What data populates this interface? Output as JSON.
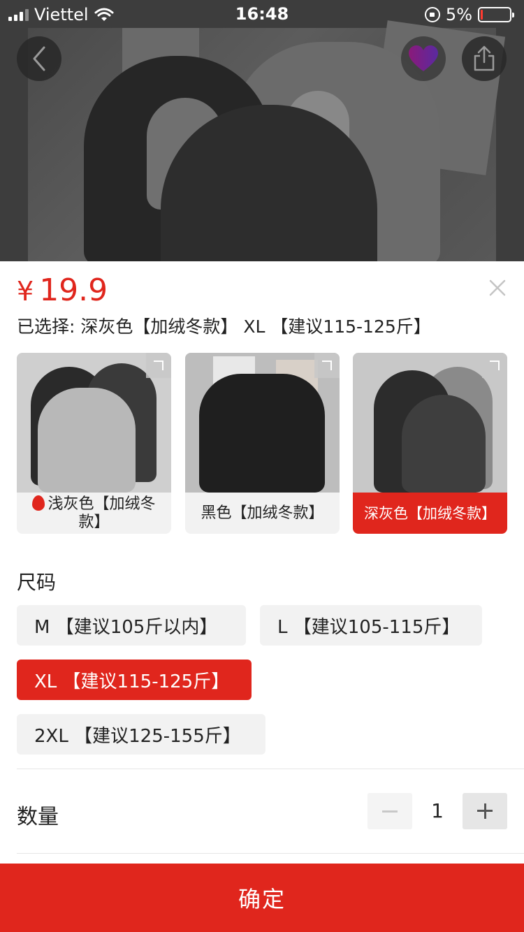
{
  "status_bar": {
    "carrier": "Viettel",
    "time": "16:48",
    "battery_percent": "5%",
    "battery_level": 0.05,
    "icons": [
      "signal-icon",
      "wifi-icon",
      "rotation-lock-icon",
      "battery-icon"
    ]
  },
  "header": {
    "back_icon": "chevron-left-icon",
    "favorite_icon": "heart-icon",
    "share_icon": "share-icon"
  },
  "product": {
    "currency": "¥",
    "price": "19.9",
    "selected_text": "已选择: 深灰色【加绒冬款】 XL 【建议115-125斤】",
    "close_icon": "close-icon"
  },
  "colors": {
    "accent": "#e0261d",
    "option_bg": "#f2f2f2"
  },
  "swatches": [
    {
      "label": "浅灰色【加绒冬款】",
      "hot": true,
      "active": false
    },
    {
      "label": "黑色【加绒冬款】",
      "hot": false,
      "active": false
    },
    {
      "label": "深灰色【加绒冬款】",
      "hot": false,
      "active": true
    }
  ],
  "sizes": {
    "title": "尺码",
    "options": [
      {
        "label": "M 【建议105斤以内】",
        "active": false
      },
      {
        "label": "L 【建议105-115斤】",
        "active": false
      },
      {
        "label": "XL 【建议115-125斤】",
        "active": true
      },
      {
        "label": "2XL 【建议125-155斤】",
        "active": false
      }
    ]
  },
  "quantity": {
    "label": "数量",
    "value": "1",
    "minus_icon": "minus-icon",
    "plus_icon": "plus-icon"
  },
  "confirm": {
    "label": "确定"
  }
}
